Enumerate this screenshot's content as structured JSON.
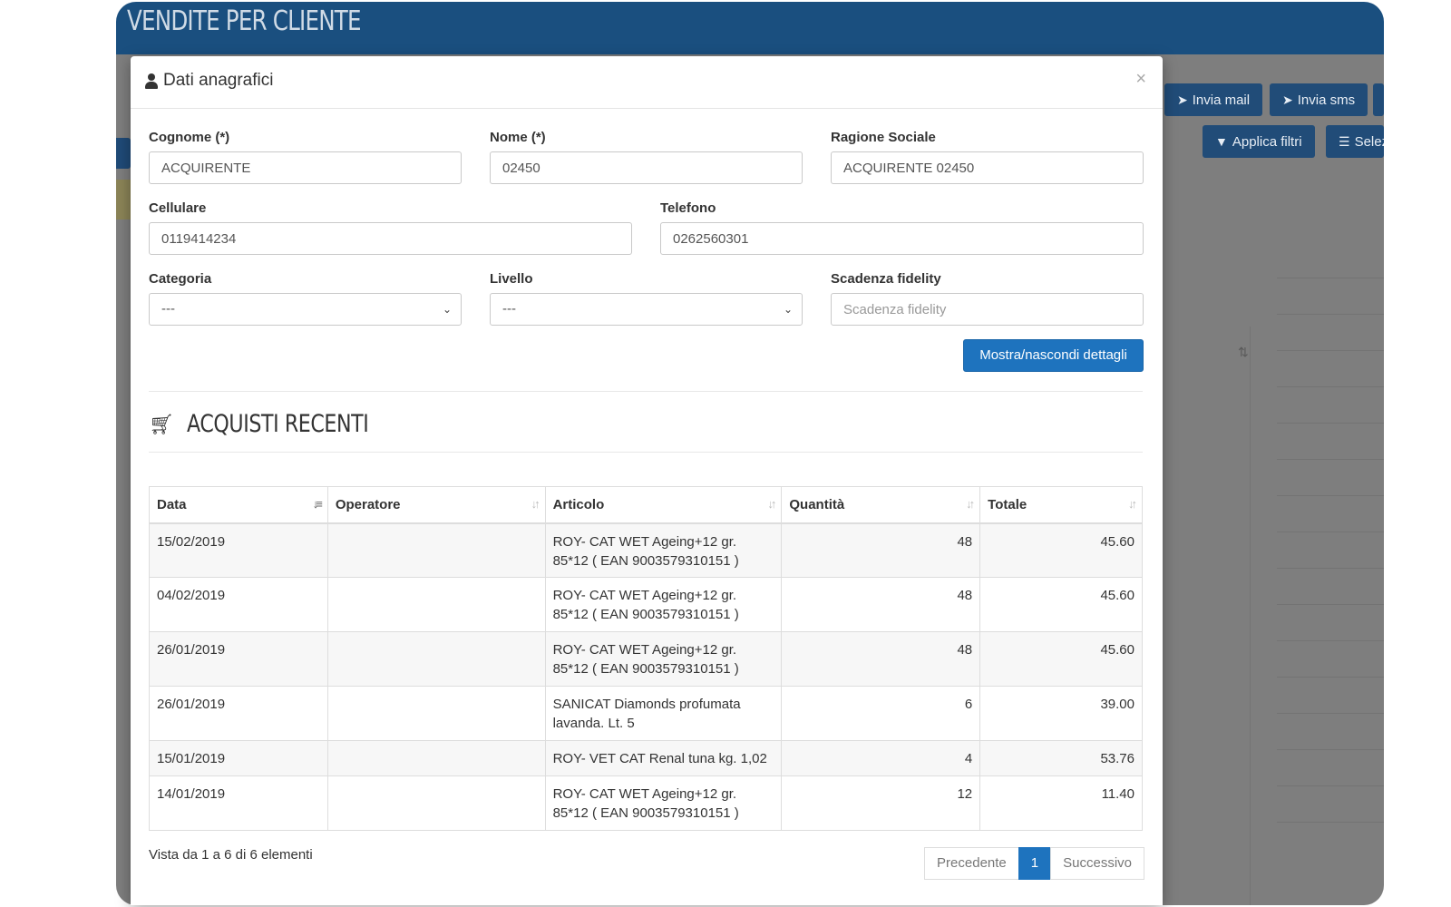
{
  "app": {
    "title": "VENDITE PER CLIENTE",
    "buttons": {
      "invia_mail": "Invia mail",
      "invia_sms": "Invia sms",
      "applica_filtri": "Applica filtri",
      "seleziona": "Selez"
    }
  },
  "modal": {
    "title": "Dati anagrafici",
    "close": "×",
    "fields": {
      "cognome": {
        "label": "Cognome (*)",
        "value": "ACQUIRENTE"
      },
      "nome": {
        "label": "Nome (*)",
        "value": "02450"
      },
      "ragione_sociale": {
        "label": "Ragione Sociale",
        "value": "ACQUIRENTE 02450"
      },
      "cellulare": {
        "label": "Cellulare",
        "value": "0119414234"
      },
      "telefono": {
        "label": "Telefono",
        "value": "0262560301"
      },
      "categoria": {
        "label": "Categoria",
        "value": "---"
      },
      "livello": {
        "label": "Livello",
        "value": "---"
      },
      "scadenza_fidelity": {
        "label": "Scadenza fidelity",
        "value": "",
        "placeholder": "Scadenza fidelity"
      }
    },
    "details_button": "Mostra/nascondi dettagli",
    "section_title": "ACQUISTI RECENTI",
    "table": {
      "columns": [
        "Data",
        "Operatore",
        "Articolo",
        "Quantità",
        "Totale"
      ],
      "rows": [
        {
          "data": "15/02/2019",
          "operatore": "",
          "articolo": "ROY- CAT WET Ageing+12 gr. 85*12 ( EAN 9003579310151 )",
          "quantita": "48",
          "totale": "45.60"
        },
        {
          "data": "04/02/2019",
          "operatore": "",
          "articolo": "ROY- CAT WET Ageing+12 gr. 85*12 ( EAN 9003579310151 )",
          "quantita": "48",
          "totale": "45.60"
        },
        {
          "data": "26/01/2019",
          "operatore": "",
          "articolo": "ROY- CAT WET Ageing+12 gr. 85*12 ( EAN 9003579310151 )",
          "quantita": "48",
          "totale": "45.60"
        },
        {
          "data": "26/01/2019",
          "operatore": "",
          "articolo": "SANICAT Diamonds profumata lavanda. Lt. 5",
          "quantita": "6",
          "totale": "39.00"
        },
        {
          "data": "15/01/2019",
          "operatore": "",
          "articolo": "ROY- VET CAT Renal tuna kg. 1,02",
          "quantita": "4",
          "totale": "53.76"
        },
        {
          "data": "14/01/2019",
          "operatore": "",
          "articolo": "ROY- CAT WET Ageing+12 gr. 85*12 ( EAN 9003579310151 )",
          "quantita": "12",
          "totale": "11.40"
        }
      ]
    },
    "footer_info": "Vista da 1 a 6 di 6 elementi",
    "pagination": {
      "prev": "Precedente",
      "page": "1",
      "next": "Successivo"
    }
  }
}
